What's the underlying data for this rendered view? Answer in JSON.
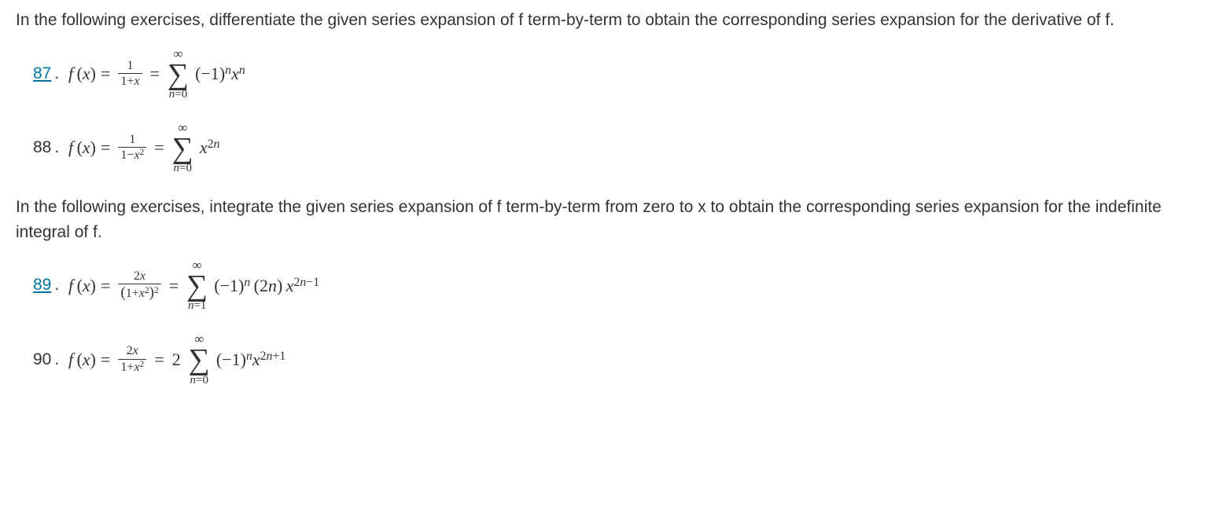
{
  "instruction1": "In the following exercises, differentiate the given series expansion of f term-by-term to obtain the corresponding series expansion for the derivative of f.",
  "instruction2": "In the following exercises, integrate the given series expansion of f term-by-term from zero to x to obtain the corresponding series expansion for the indefinite integral of f.",
  "ex87": {
    "number": "87",
    "is_link": true,
    "function_lhs": "f (x) =",
    "frac_num": "1",
    "frac_den": "1+x",
    "sum_lower": "n=0",
    "sum_upper": "∞",
    "term_display": "(−1)ⁿxⁿ"
  },
  "ex88": {
    "number": "88",
    "is_link": false,
    "function_lhs": "f (x) =",
    "frac_num": "1",
    "frac_den": "1−x²",
    "sum_lower": "n=0",
    "sum_upper": "∞",
    "term_display": "x²ⁿ"
  },
  "ex89": {
    "number": "89",
    "is_link": true,
    "function_lhs": "f (x) =",
    "frac_num": "2x",
    "frac_den": "(1+x²)²",
    "sum_lower": "n=1",
    "sum_upper": "∞",
    "term_display": "(−1)ⁿ (2n) x²ⁿ⁻¹"
  },
  "ex90": {
    "number": "90",
    "is_link": false,
    "function_lhs": "f (x) =",
    "frac_num": "2x",
    "frac_den": "1+x²",
    "coef": "2",
    "sum_lower": "n=0",
    "sum_upper": "∞",
    "term_display": "(−1)ⁿx²ⁿ⁺¹"
  }
}
